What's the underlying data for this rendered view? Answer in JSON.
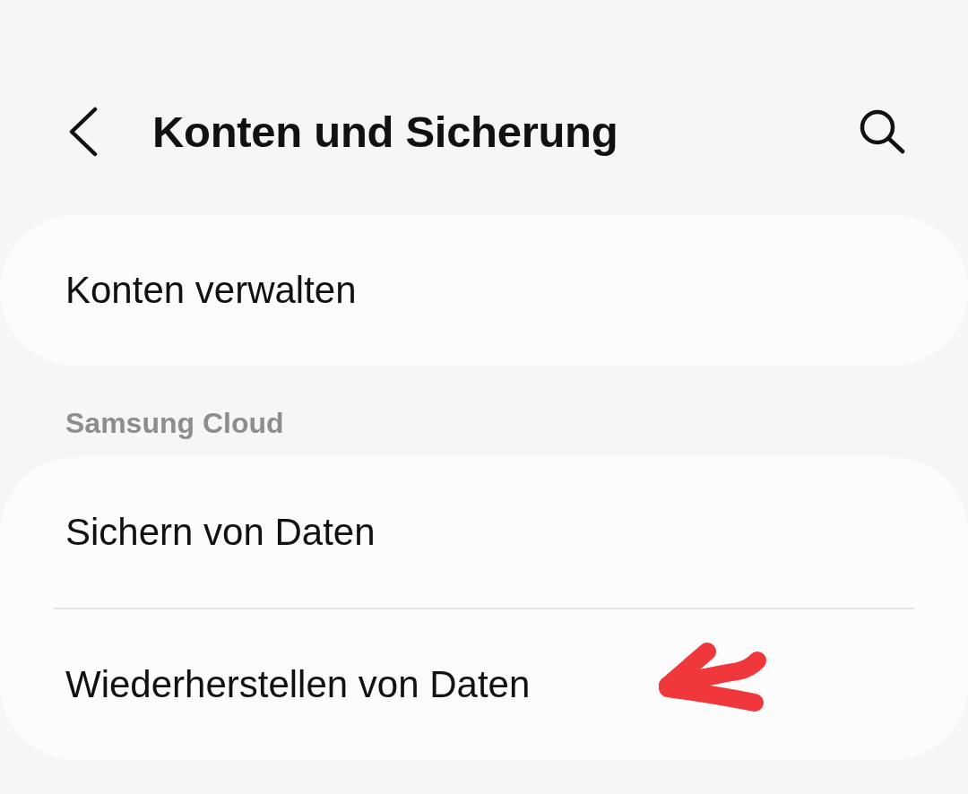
{
  "header": {
    "title": "Konten und Sicherung"
  },
  "groups": [
    {
      "items": [
        {
          "label": "Konten verwalten",
          "marked": false
        }
      ]
    },
    {
      "heading": "Samsung Cloud",
      "items": [
        {
          "label": "Sichern von Daten",
          "marked": false
        },
        {
          "label": "Wiederherstellen von Daten",
          "marked": true
        }
      ]
    }
  ]
}
